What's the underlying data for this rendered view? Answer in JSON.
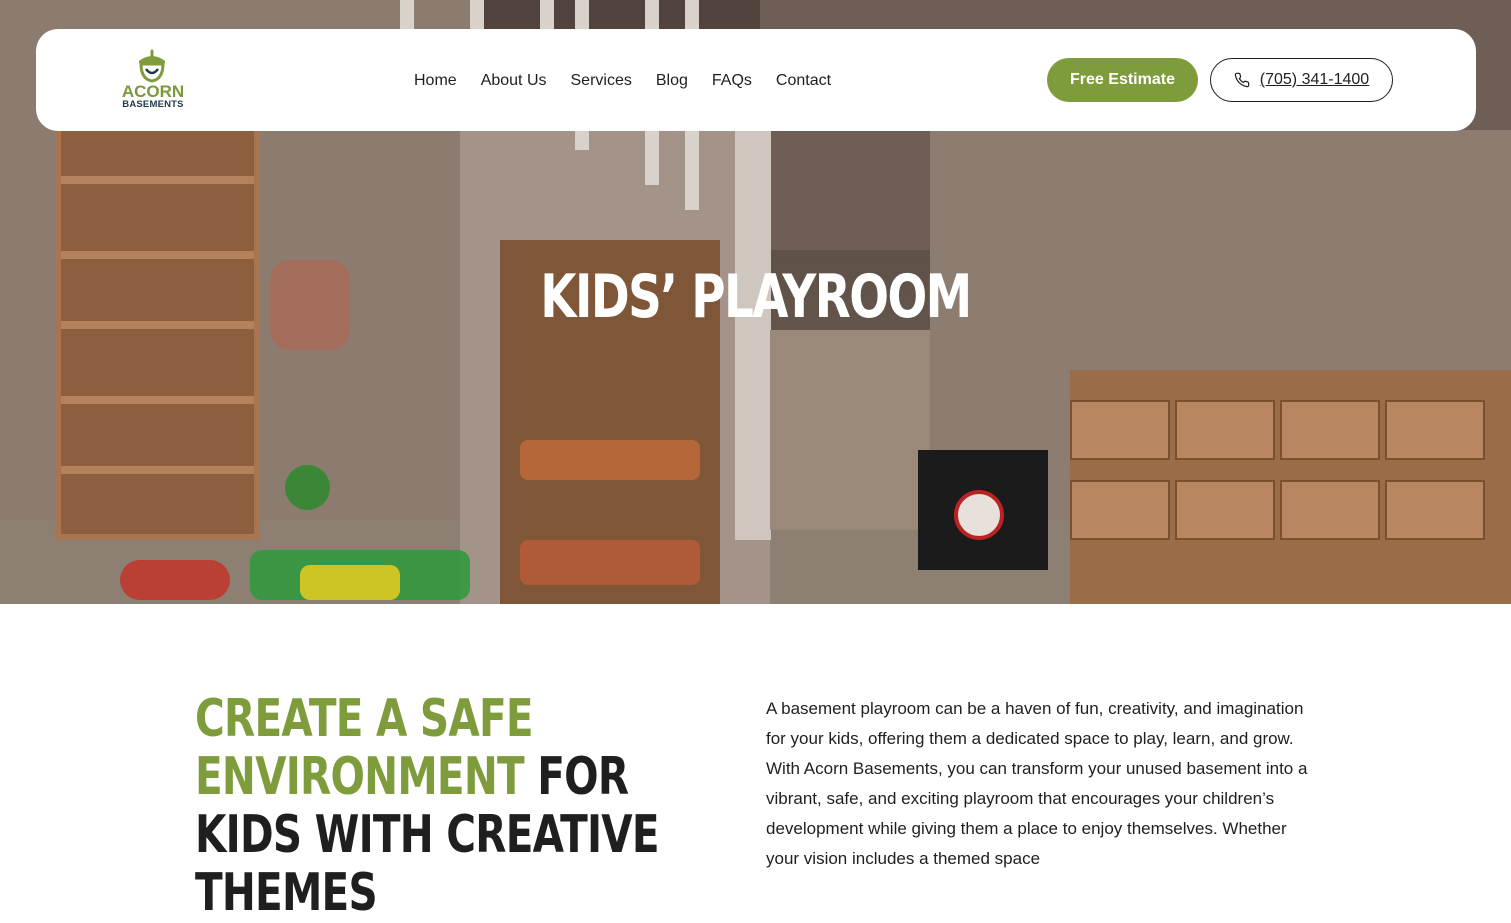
{
  "header": {
    "logo": {
      "word1": "ACORN",
      "word2": "BASEMENTS",
      "icon": "acorn-icon"
    },
    "nav": [
      {
        "label": "Home"
      },
      {
        "label": "About Us"
      },
      {
        "label": "Services"
      },
      {
        "label": "Blog"
      },
      {
        "label": "FAQs"
      },
      {
        "label": "Contact"
      }
    ],
    "estimate_label": "Free Estimate",
    "phone_label": "(705) 341-1400",
    "phone_icon": "phone-icon"
  },
  "hero": {
    "title": "Kids’ Playroom"
  },
  "intro": {
    "heading_green": "Create a Safe Environment",
    "heading_dark": "for Kids with Creative Themes",
    "body": "A basement playroom can be a haven of fun, creativity, and imagination for your kids, offering them a dedicated space to play, learn, and grow. With Acorn Basements, you can transform your unused basement into a vibrant, safe, and exciting playroom that encourages your children’s development while giving them a place to enjoy themselves. Whether your vision includes a themed space"
  },
  "colors": {
    "accent": "#7e9c3c",
    "text": "#1f1f1f",
    "header_bg": "#ffffff"
  }
}
